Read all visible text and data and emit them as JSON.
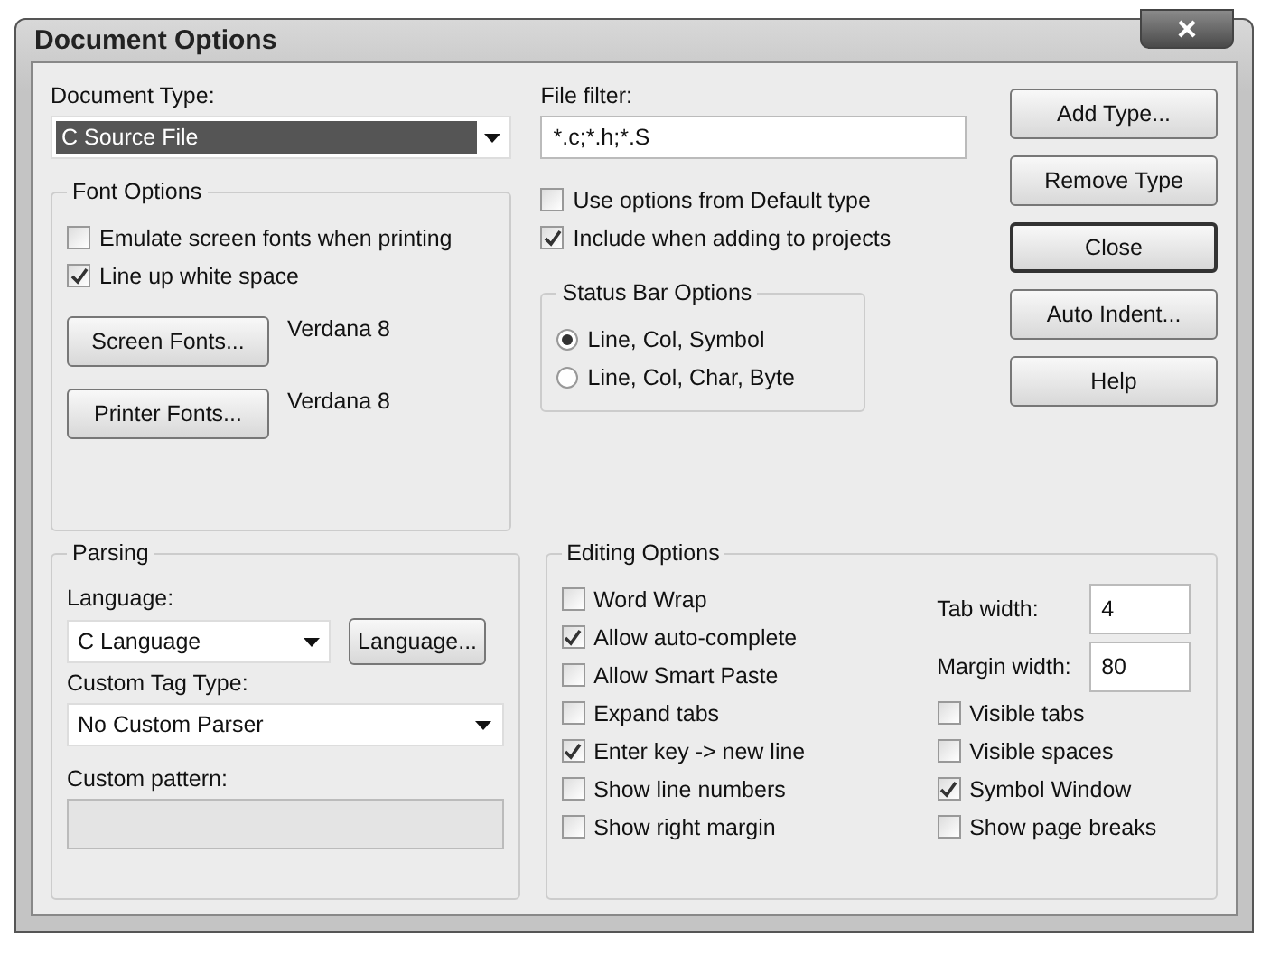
{
  "window": {
    "title": "Document Options"
  },
  "document_type": {
    "label": "Document Type:",
    "value": "C Source File"
  },
  "file_filter": {
    "label": "File filter:",
    "value": "*.c;*.h;*.S"
  },
  "font_options": {
    "title": "Font Options",
    "checkboxes": [
      {
        "label": "Emulate screen fonts when printing",
        "checked": false
      },
      {
        "label": "Line up white space",
        "checked": true
      }
    ],
    "fonts": [
      {
        "button": "Screen Fonts...",
        "value": "Verdana 8"
      },
      {
        "button": "Printer Fonts...",
        "value": "Verdana 8"
      }
    ]
  },
  "type_options": [
    {
      "label": "Use options from Default type",
      "checked": false
    },
    {
      "label": "Include when adding to projects",
      "checked": true
    }
  ],
  "status_bar_options": {
    "title": "Status Bar Options",
    "radios": [
      {
        "label": "Line, Col, Symbol",
        "selected": true
      },
      {
        "label": "Line, Col, Char, Byte",
        "selected": false
      }
    ]
  },
  "buttons": [
    {
      "label": "Add Type...",
      "default": false
    },
    {
      "label": "Remove Type",
      "default": false
    },
    {
      "label": "Close",
      "default": true
    },
    {
      "label": "Auto Indent...",
      "default": false
    },
    {
      "label": "Help",
      "default": false
    }
  ],
  "parsing": {
    "title": "Parsing",
    "language_label": "Language:",
    "language_value": "C Language",
    "language_button": "Language...",
    "tag_label": "Custom Tag Type:",
    "tag_value": "No Custom Parser",
    "pattern_label": "Custom pattern:"
  },
  "editing_options": {
    "title": "Editing Options",
    "left": [
      {
        "label": "Word Wrap",
        "checked": false
      },
      {
        "label": "Allow auto-complete",
        "checked": true
      },
      {
        "label": "Allow Smart Paste",
        "checked": false
      },
      {
        "label": "Expand tabs",
        "checked": false
      },
      {
        "label": "Enter key -> new line",
        "checked": true
      },
      {
        "label": "Show line numbers",
        "checked": false
      },
      {
        "label": "Show right margin",
        "checked": false
      }
    ],
    "fields": [
      {
        "label": "Tab width:",
        "value": "4"
      },
      {
        "label": "Margin width:",
        "value": "80"
      }
    ],
    "right": [
      {
        "label": "Visible tabs",
        "checked": false
      },
      {
        "label": "Visible spaces",
        "checked": false
      },
      {
        "label": "Symbol Window",
        "checked": true
      },
      {
        "label": "Show page breaks",
        "checked": false
      }
    ]
  }
}
